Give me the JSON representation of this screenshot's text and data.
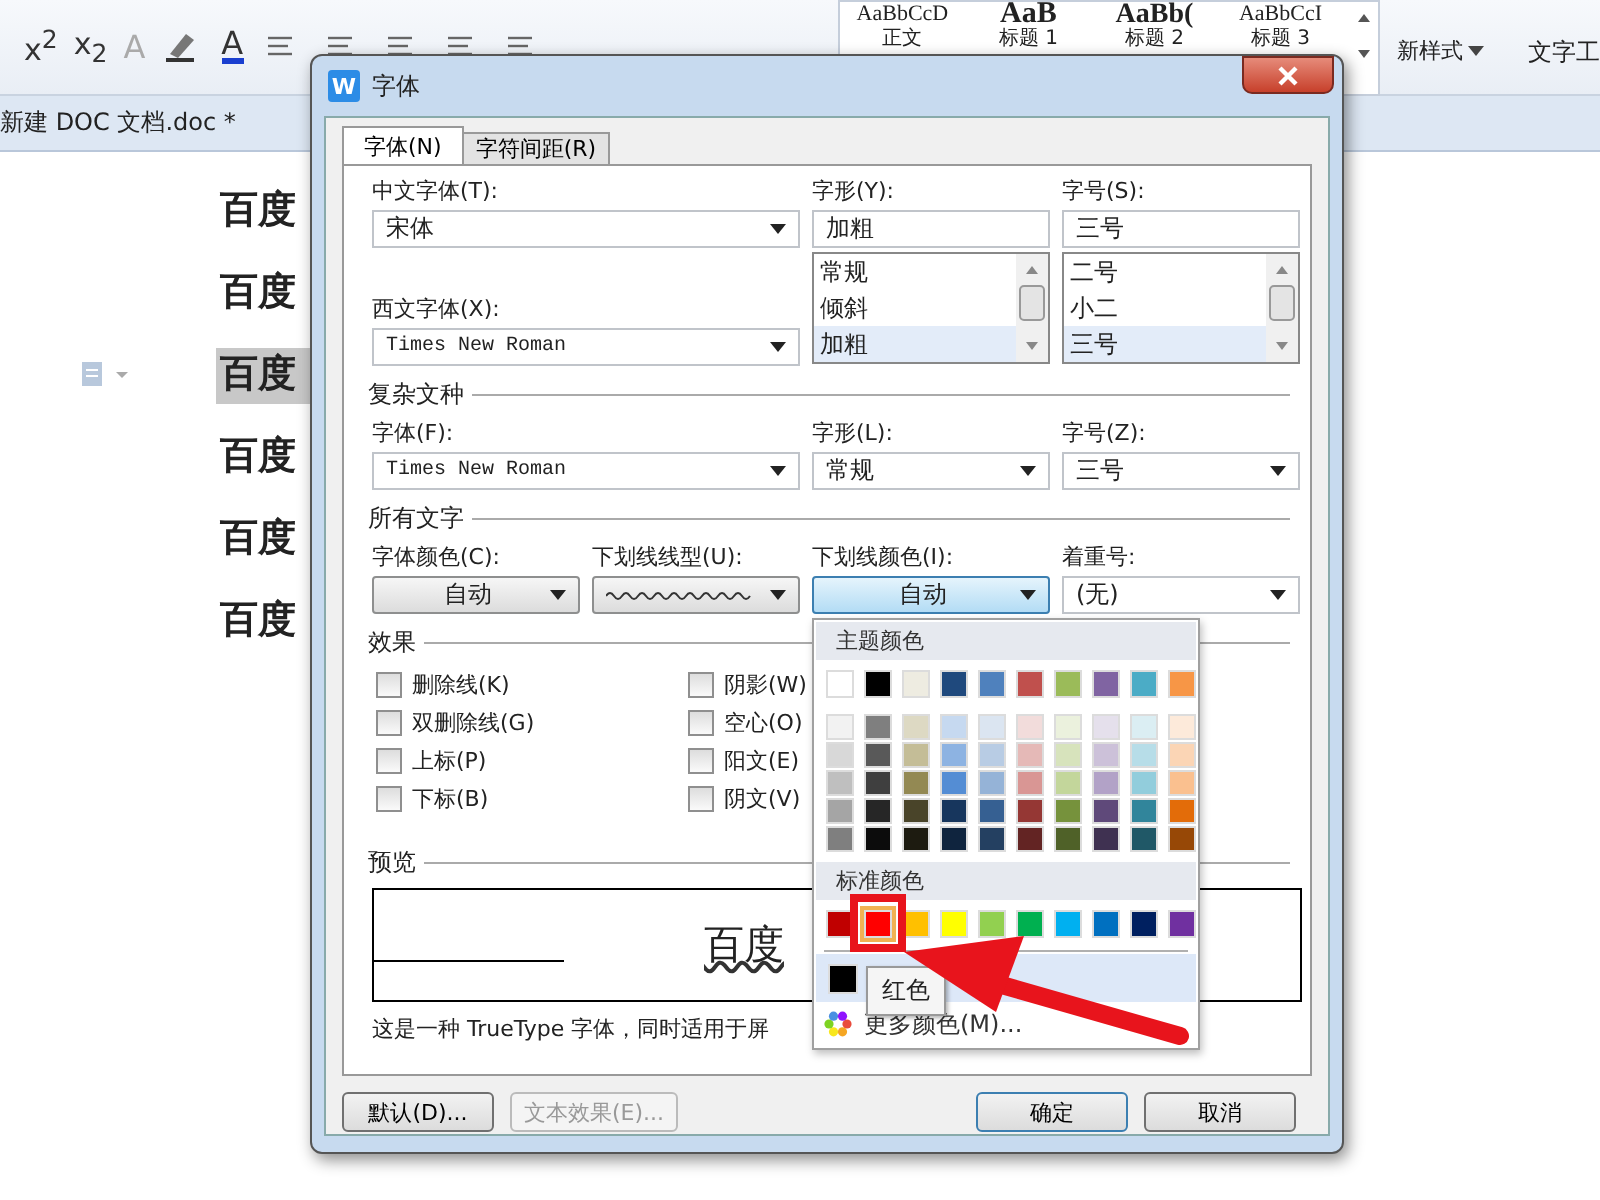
{
  "ribbon": {
    "superscript": "x$^{2}$",
    "subscript": "x$_{2}$",
    "text_effect": "A",
    "font_color": "A",
    "styles": [
      {
        "sample": "AaBbCcD",
        "name": "正文",
        "kind": "body"
      },
      {
        "sample": "AaB",
        "name": "标题 1",
        "kind": "h1"
      },
      {
        "sample": "AaBb(",
        "name": "标题 2",
        "kind": "h2"
      },
      {
        "sample": "AaBbCcI",
        "name": "标题 3",
        "kind": "h3"
      }
    ],
    "new_style": "新样式",
    "text_tools": "文字工"
  },
  "document_tab": "新建 DOC 文档.doc *",
  "document_lines": [
    {
      "text": "百度",
      "selected": false
    },
    {
      "text": "百度",
      "selected": false
    },
    {
      "text": "百度",
      "selected": true
    },
    {
      "text": "百度",
      "selected": false
    },
    {
      "text": "百度",
      "selected": false
    },
    {
      "text": "百度",
      "selected": false
    }
  ],
  "dialog": {
    "icon_letter": "W",
    "title": "字体",
    "tabs": [
      {
        "label": "字体(N)",
        "selected": true
      },
      {
        "label": "字符间距(R)",
        "selected": false
      }
    ],
    "chinese_font": {
      "label": "中文字体(T):",
      "value": "宋体"
    },
    "western_font": {
      "label": "西文字体(X):",
      "value": "Times New Roman"
    },
    "style": {
      "label": "字形(Y):",
      "value": "加粗",
      "options": [
        {
          "text": "常规",
          "selected": false
        },
        {
          "text": "倾斜",
          "selected": false
        },
        {
          "text": "加粗",
          "selected": true
        }
      ]
    },
    "size": {
      "label": "字号(S):",
      "value": "三号",
      "options": [
        {
          "text": "二号",
          "selected": false
        },
        {
          "text": "小二",
          "selected": false
        },
        {
          "text": "三号",
          "selected": true
        }
      ]
    },
    "complex_script": {
      "heading": "复杂文种",
      "font": {
        "label": "字体(F):",
        "value": "Times New Roman"
      },
      "style": {
        "label": "字形(L):",
        "value": "常规"
      },
      "size": {
        "label": "字号(Z):",
        "value": "三号"
      }
    },
    "all_text": {
      "heading": "所有文字",
      "font_color": {
        "label": "字体颜色(C):",
        "value": "自动"
      },
      "underline_style": {
        "label": "下划线线型(U):"
      },
      "underline_color": {
        "label": "下划线颜色(I):",
        "value": "自动",
        "expanded": true
      },
      "emphasis": {
        "label": "着重号:",
        "value": "(无)"
      }
    },
    "effects": {
      "heading": "效果",
      "items": [
        {
          "label": "删除线(K)",
          "checked": false
        },
        {
          "label": "双删除线(G)",
          "checked": false
        },
        {
          "label": "上标(P)",
          "checked": false
        },
        {
          "label": "下标(B)",
          "checked": false
        },
        {
          "label": "阴影(W)",
          "checked": false
        },
        {
          "label": "空心(O)",
          "checked": false
        },
        {
          "label": "阳文(E)",
          "checked": false
        },
        {
          "label": "阴文(V)",
          "checked": false
        }
      ]
    },
    "preview": {
      "heading": "预览",
      "sample": "百度",
      "note": "这是一种 TrueType 字体，同时适用于屏"
    },
    "buttons": [
      {
        "label": "默认(D)...",
        "disabled": false,
        "kind": "left"
      },
      {
        "label": "文本效果(E)...",
        "disabled": true,
        "kind": "left"
      },
      {
        "label": "确定",
        "disabled": false,
        "kind": "right"
      },
      {
        "label": "取消",
        "disabled": false,
        "kind": "right"
      }
    ]
  },
  "color_menu": {
    "theme_heading": "主题颜色",
    "theme_row": [
      {
        "color": "#ffffff"
      },
      {
        "color": "#000000"
      },
      {
        "color": "#eeece1"
      },
      {
        "color": "#1f497d"
      },
      {
        "color": "#4f81bd"
      },
      {
        "color": "#c0504d"
      },
      {
        "color": "#9bbb59"
      },
      {
        "color": "#8064a2"
      },
      {
        "color": "#4bacc6"
      },
      {
        "color": "#f79646"
      }
    ],
    "shade_rows": [
      {
        "swatches": [
          {
            "color": "#f2f2f2"
          },
          {
            "color": "#7f7f7f"
          },
          {
            "color": "#ddd9c3"
          },
          {
            "color": "#c6d9f0"
          },
          {
            "color": "#dbe5f1"
          },
          {
            "color": "#f2dcdb"
          },
          {
            "color": "#ebf1dd"
          },
          {
            "color": "#e5e0ec"
          },
          {
            "color": "#dbeef3"
          },
          {
            "color": "#fdeada"
          }
        ]
      },
      {
        "swatches": [
          {
            "color": "#d8d8d8"
          },
          {
            "color": "#595959"
          },
          {
            "color": "#c4bd97"
          },
          {
            "color": "#8db3e2"
          },
          {
            "color": "#b8cce4"
          },
          {
            "color": "#e5b9b7"
          },
          {
            "color": "#d7e3bc"
          },
          {
            "color": "#ccc1d9"
          },
          {
            "color": "#b7dde8"
          },
          {
            "color": "#fbd5b5"
          }
        ]
      },
      {
        "swatches": [
          {
            "color": "#bfbfbf"
          },
          {
            "color": "#3f3f3f"
          },
          {
            "color": "#938953"
          },
          {
            "color": "#548dd4"
          },
          {
            "color": "#95b3d7"
          },
          {
            "color": "#d99694"
          },
          {
            "color": "#c3d69b"
          },
          {
            "color": "#b2a2c7"
          },
          {
            "color": "#92cddc"
          },
          {
            "color": "#fac08f"
          }
        ]
      },
      {
        "swatches": [
          {
            "color": "#a5a5a5"
          },
          {
            "color": "#262626"
          },
          {
            "color": "#494429"
          },
          {
            "color": "#17365d"
          },
          {
            "color": "#366092"
          },
          {
            "color": "#953734"
          },
          {
            "color": "#76923c"
          },
          {
            "color": "#5f497a"
          },
          {
            "color": "#31859b"
          },
          {
            "color": "#e36c09"
          }
        ]
      },
      {
        "swatches": [
          {
            "color": "#7f7f7f"
          },
          {
            "color": "#0c0c0c"
          },
          {
            "color": "#1d1b10"
          },
          {
            "color": "#0f243e"
          },
          {
            "color": "#244061"
          },
          {
            "color": "#632423"
          },
          {
            "color": "#4f6128"
          },
          {
            "color": "#3f3151"
          },
          {
            "color": "#205867"
          },
          {
            "color": "#974806"
          }
        ]
      }
    ],
    "standard_heading": "标准颜色",
    "standard": [
      {
        "color": "#c00000",
        "hovered": false
      },
      {
        "color": "#ff0000",
        "hovered": true
      },
      {
        "color": "#ffc000",
        "hovered": false
      },
      {
        "color": "#ffff00",
        "hovered": false
      },
      {
        "color": "#92d050",
        "hovered": false
      },
      {
        "color": "#00b050",
        "hovered": false
      },
      {
        "color": "#00b0f0",
        "hovered": false
      },
      {
        "color": "#0070c0",
        "hovered": false
      },
      {
        "color": "#002060",
        "hovered": false
      },
      {
        "color": "#7030a0",
        "hovered": false
      }
    ],
    "recent": [
      {
        "color": "#000000"
      }
    ],
    "more": "更多颜色(M)...",
    "tooltip": "红色"
  }
}
